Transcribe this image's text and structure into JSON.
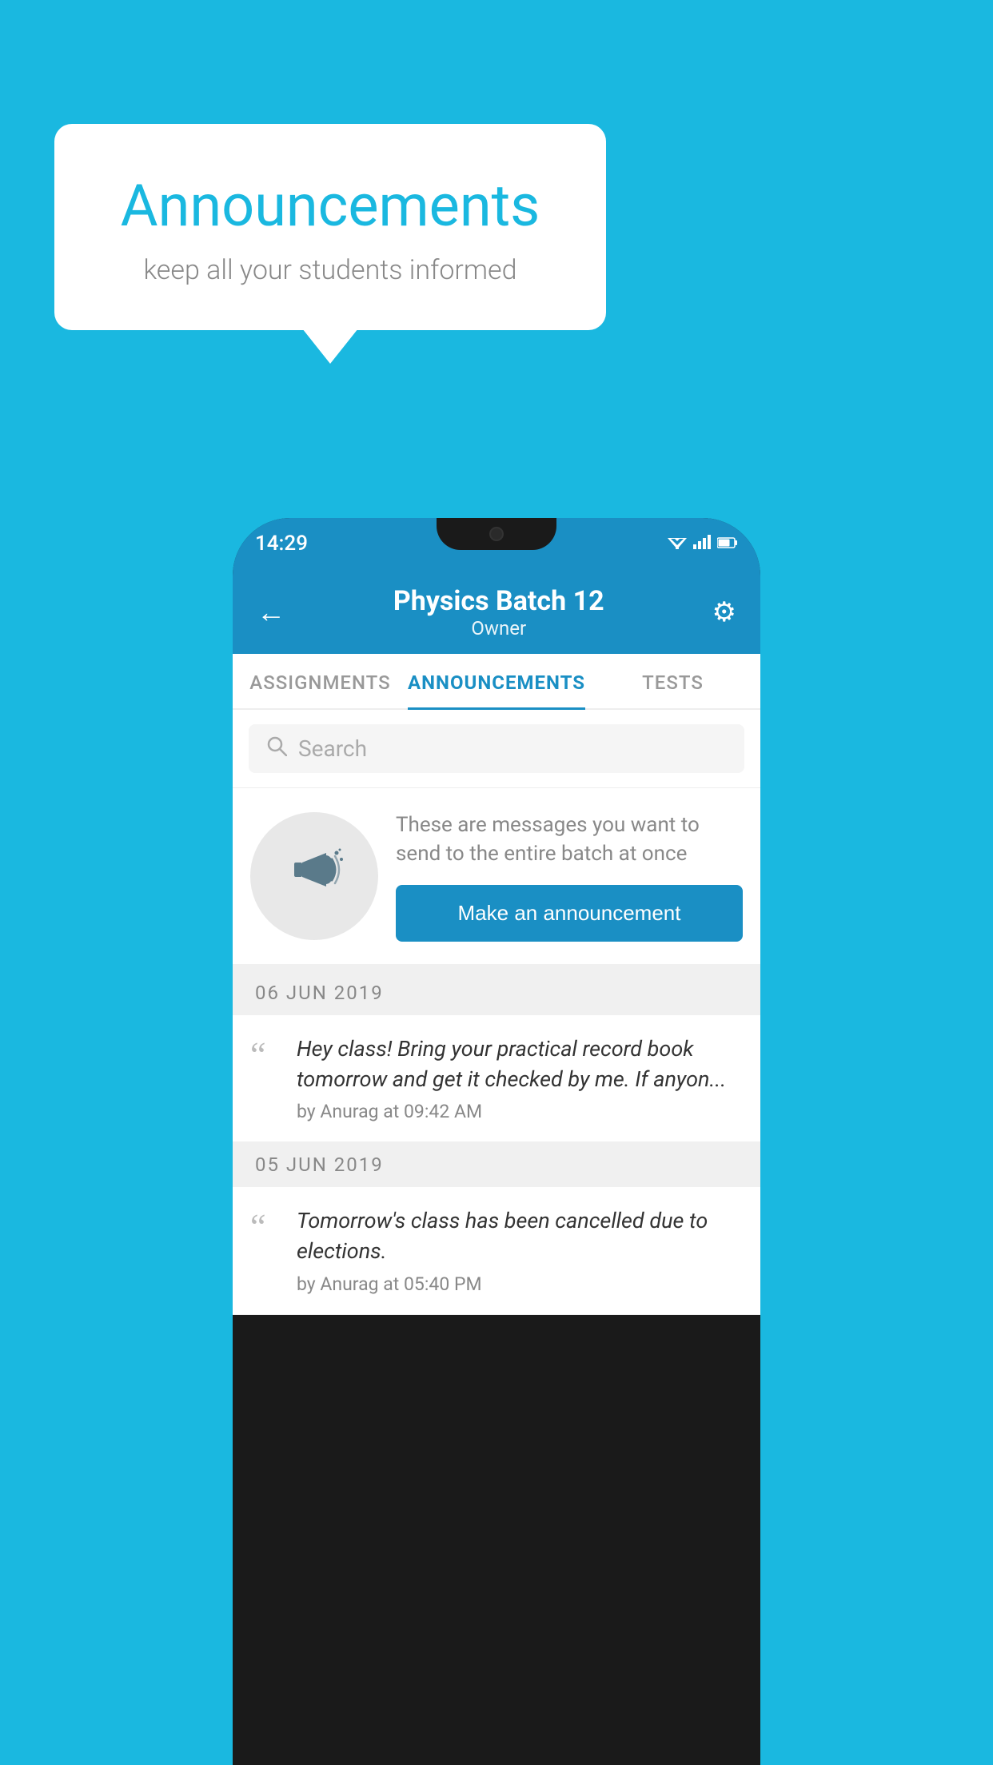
{
  "background": {
    "color": "#1ab8e0"
  },
  "speech_bubble": {
    "title": "Announcements",
    "subtitle": "keep all your students informed"
  },
  "phone": {
    "status_bar": {
      "time": "14:29",
      "icons": [
        "wifi",
        "signal",
        "battery"
      ]
    },
    "header": {
      "back_label": "←",
      "title": "Physics Batch 12",
      "subtitle": "Owner",
      "gear_label": "⚙"
    },
    "tabs": [
      {
        "label": "ASSIGNMENTS",
        "active": false
      },
      {
        "label": "ANNOUNCEMENTS",
        "active": true
      },
      {
        "label": "TESTS",
        "active": false
      },
      {
        "label": "...",
        "active": false
      }
    ],
    "search": {
      "placeholder": "Search"
    },
    "promo": {
      "description": "These are messages you want to send to the entire batch at once",
      "button_label": "Make an announcement"
    },
    "announcements": [
      {
        "date": "06  JUN  2019",
        "text": "Hey class! Bring your practical record book tomorrow and get it checked by me. If anyon...",
        "meta": "by Anurag at 09:42 AM"
      },
      {
        "date": "05  JUN  2019",
        "text": "Tomorrow's class has been cancelled due to elections.",
        "meta": "by Anurag at 05:40 PM"
      }
    ]
  }
}
